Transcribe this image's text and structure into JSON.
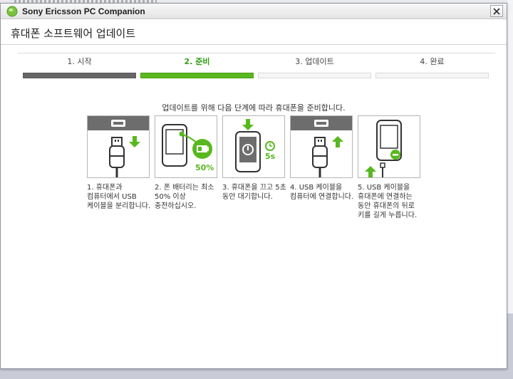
{
  "window": {
    "title": "Sony Ericsson PC Companion",
    "close_icon": "close-icon",
    "app_icon": "sony-ericsson-logo-icon"
  },
  "page": {
    "title": "휴대폰 소프트웨어 업데이트",
    "instruction": "업데이트를 위해 다음 단계에 따라 휴대폰을 준비합니다."
  },
  "steps": [
    {
      "label": "1. 시작",
      "state": "done"
    },
    {
      "label": "2. 준비",
      "state": "active"
    },
    {
      "label": "3. 업데이트",
      "state": "pending"
    },
    {
      "label": "4. 완료",
      "state": "pending"
    }
  ],
  "instructions": [
    {
      "caption": "1. 휴대폰과 컴퓨터에서 USB 케이블을 분리합니다.",
      "icon": "usb-unplug-icon"
    },
    {
      "caption": "2. 폰 배터리는 최소 50% 이상 충전하십시오.",
      "icon": "battery-charge-icon",
      "badge": "50%"
    },
    {
      "caption": "3. 휴대폰을 끄고 5초 동안 대기합니다.",
      "icon": "phone-power-off-icon",
      "badge": "5s"
    },
    {
      "caption": "4. USB 케이블을 컴퓨터에 연결합니다.",
      "icon": "usb-plug-in-icon"
    },
    {
      "caption": "5. USB 케이블을 휴대폰에 연결하는 동안 휴대폰의 뒤로 키를 길게 누릅니다.",
      "icon": "phone-back-key-icon"
    }
  ],
  "colors": {
    "accent_green": "#58b81f",
    "dark_gray": "#666666"
  }
}
